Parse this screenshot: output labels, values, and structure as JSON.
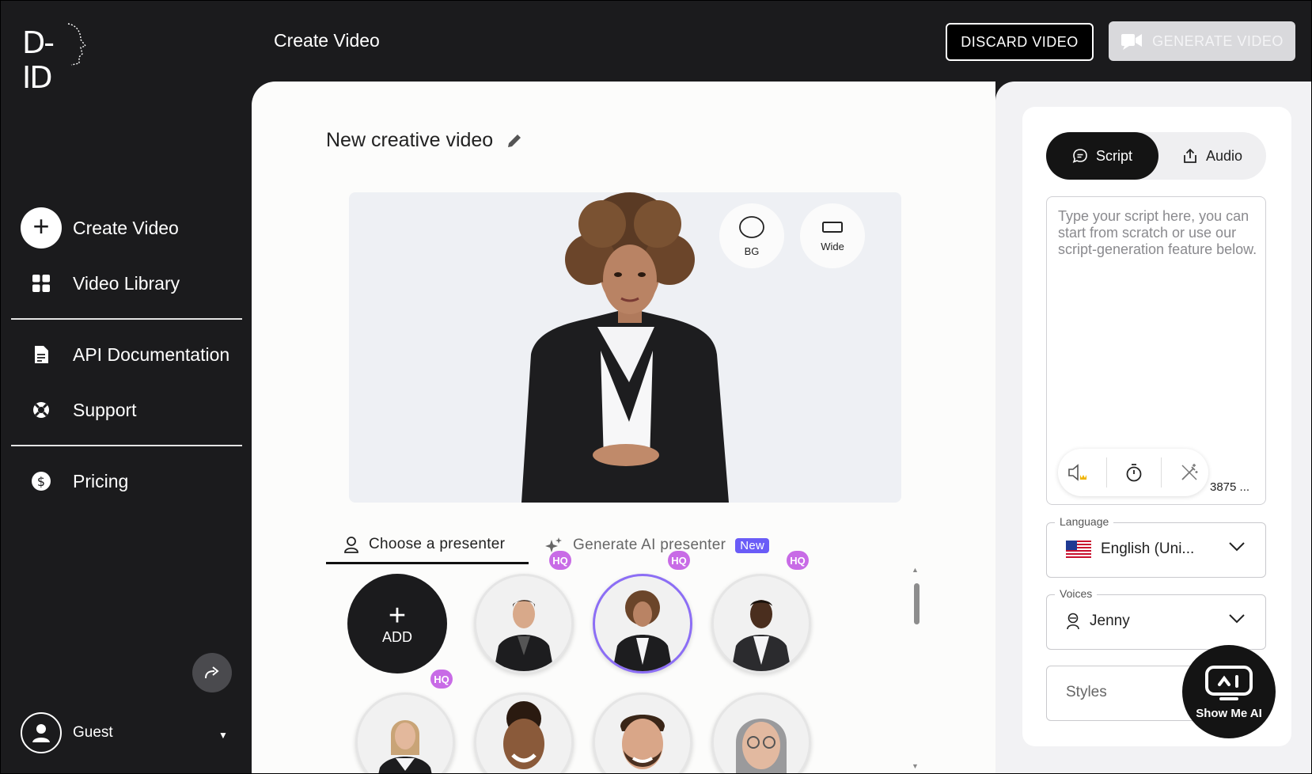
{
  "app": {
    "logo_text": "D-ID"
  },
  "header": {
    "title": "Create Video",
    "discard_label": "DISCARD VIDEO",
    "generate_label": "GENERATE VIDEO"
  },
  "sidebar": {
    "items": [
      {
        "label": "Create Video",
        "icon": "plus-icon"
      },
      {
        "label": "Video Library",
        "icon": "grid-icon"
      },
      {
        "label": "API Documentation",
        "icon": "document-icon"
      },
      {
        "label": "Support",
        "icon": "lifebuoy-icon"
      },
      {
        "label": "Pricing",
        "icon": "dollar-icon"
      }
    ],
    "user": {
      "name": "Guest"
    }
  },
  "editor": {
    "video_title": "New creative video",
    "stage_buttons": {
      "bg": "BG",
      "wide": "Wide"
    },
    "tabs": {
      "choose": "Choose a presenter",
      "generate": "Generate AI presenter",
      "new_badge": "New"
    },
    "add_label": "ADD",
    "hq_label": "HQ",
    "presenters": [
      {
        "name": "presenter-man-1",
        "hq": true,
        "selected": false
      },
      {
        "name": "presenter-woman-curly",
        "hq": true,
        "selected": true
      },
      {
        "name": "presenter-man-2",
        "hq": true,
        "selected": false
      },
      {
        "name": "presenter-woman-blonde",
        "hq": true,
        "selected": false
      },
      {
        "name": "presenter-woman-smile",
        "hq": false,
        "selected": false
      },
      {
        "name": "presenter-man-beard",
        "hq": false,
        "selected": false
      },
      {
        "name": "presenter-woman-grey",
        "hq": false,
        "selected": false
      }
    ]
  },
  "right_panel": {
    "tabs": {
      "script": "Script",
      "audio": "Audio"
    },
    "script_placeholder": "Type your script here, you can start from scratch or use our script-generation feature below.",
    "char_count": "3875 ...",
    "language": {
      "label": "Language",
      "value": "English (Uni...",
      "flag": "us-flag-icon"
    },
    "voices": {
      "label": "Voices",
      "value": "Jenny"
    },
    "styles": {
      "placeholder": "Styles"
    },
    "show_me_ai": "Show Me AI"
  },
  "colors": {
    "sidebar_bg": "#1b1b1d",
    "accent_purple": "#6a5cf7",
    "hq_badge": "#c86be6",
    "selected_ring": "#8c6ef5"
  }
}
